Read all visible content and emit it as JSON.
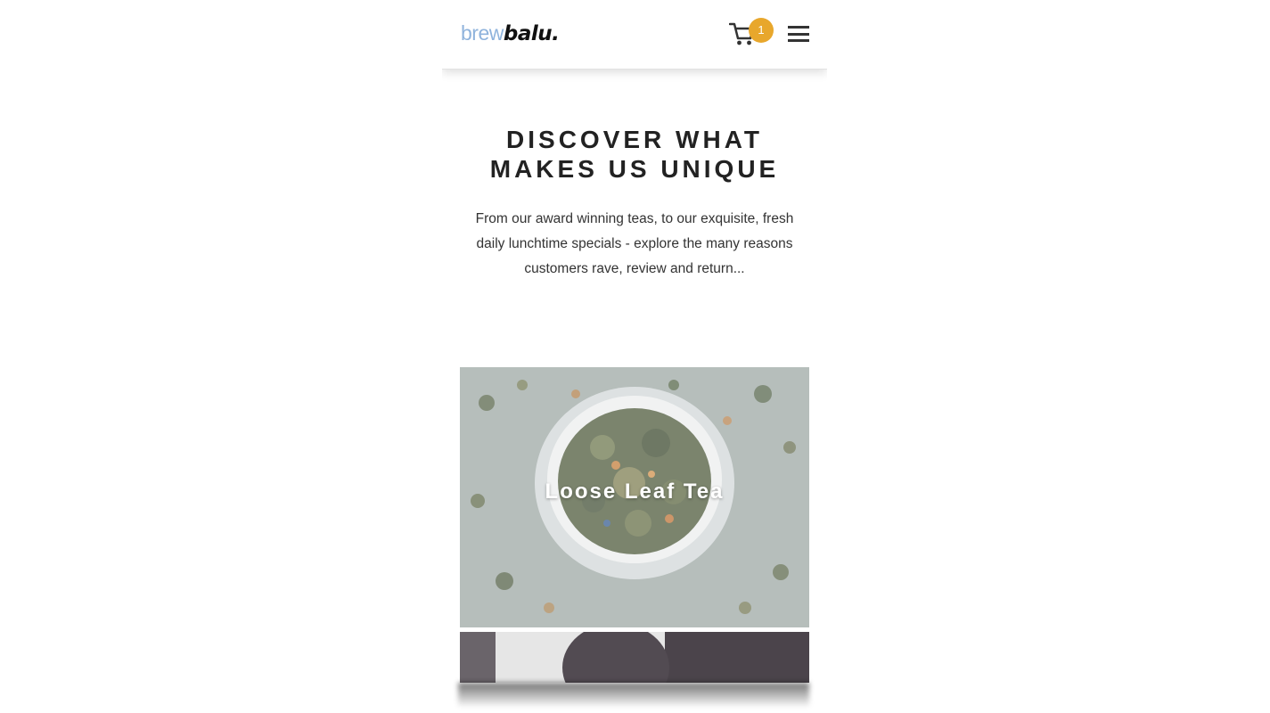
{
  "header": {
    "logo_part1": "brew",
    "logo_part2": "balu.",
    "cart_count": "1",
    "cart_icon": "cart-icon",
    "menu_icon": "hamburger-menu-icon",
    "badge_color": "#e8a72c"
  },
  "intro": {
    "title_line1": "DISCOVER WHAT",
    "title_line2": "MAKES US UNIQUE",
    "description": "From our award winning teas, to our exquisite, fresh daily lunchtime specials - explore the many reasons customers rave, review and return..."
  },
  "cards": [
    {
      "label": "Loose Leaf Tea"
    }
  ]
}
